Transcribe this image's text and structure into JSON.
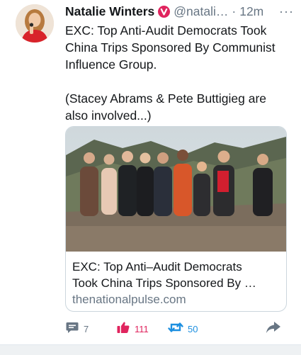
{
  "tweet": {
    "author_name": "Natalie Winters",
    "handle": "@natali…",
    "separator": "·",
    "time": "12m",
    "more": "···",
    "text_1": "EXC: Top Anti-Audit Democrats Took China Trips Sponsored By Communist Influence Group.",
    "text_2": "(Stacey Abrams & Pete Buttigieg are also involved...)"
  },
  "card": {
    "title_line1": "EXC: Top Anti–Audit Democrats",
    "title_line2": "Took China Trips Sponsored By …",
    "domain": "thenationalpulse.com"
  },
  "actions": {
    "replies": "7",
    "likes": "111",
    "retweets": "50"
  },
  "colors": {
    "verified": "#e0245e",
    "like": "#e0245e",
    "retweet": "#1d8fe0",
    "muted": "#687684"
  },
  "icons": [
    "verified-badge-icon",
    "reply-icon",
    "like-icon",
    "retweet-icon",
    "share-icon"
  ]
}
